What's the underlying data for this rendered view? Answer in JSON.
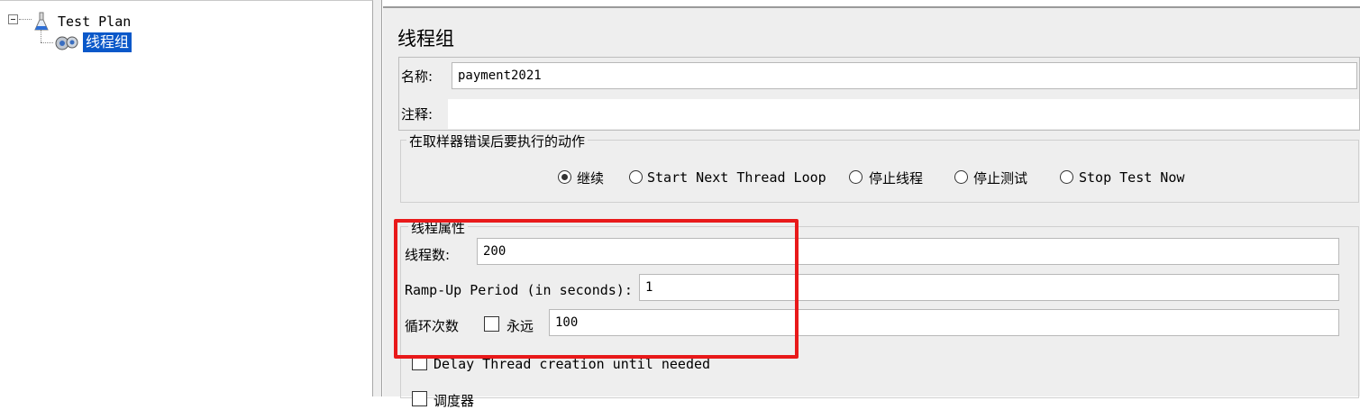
{
  "tree": {
    "root_label": "Test Plan",
    "child_label": "线程组"
  },
  "editor": {
    "title": "线程组",
    "name_label": "名称:",
    "name_value": "payment2021",
    "comment_label": "注释:",
    "comment_value": "",
    "error_group_title": "在取样器错误后要执行的动作",
    "error_options": [
      "继续",
      "Start Next Thread Loop",
      "停止线程",
      "停止测试",
      "Stop Test Now"
    ],
    "selected_error_option": "继续",
    "thread_group_title": "线程属性",
    "threads_label": "线程数:",
    "threads_value": "200",
    "rampup_label": "Ramp-Up Period (in seconds):",
    "rampup_value": "1",
    "loop_label": "循环次数",
    "forever_label": "永远",
    "forever_checked": false,
    "loop_value": "100",
    "delay_label": "Delay Thread creation until needed",
    "scheduler_label": "调度器"
  },
  "highlight": {
    "color": "#e8191a"
  },
  "colors": {
    "selection": "#0a58c9",
    "panel": "#eeeeee"
  }
}
